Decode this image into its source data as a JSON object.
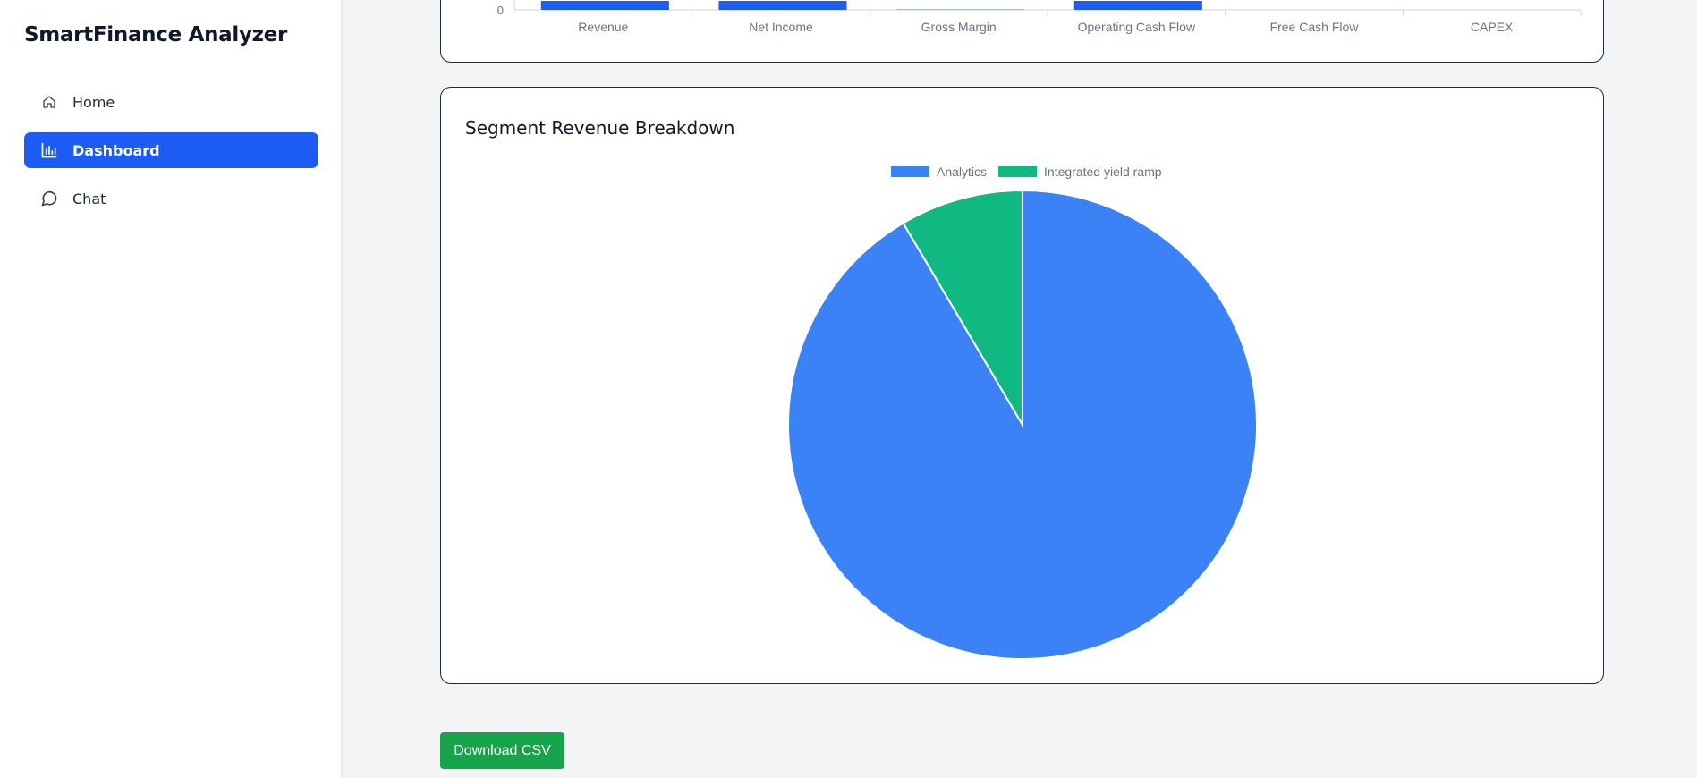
{
  "app": {
    "title": "SmartFinance Analyzer"
  },
  "sidebar": {
    "items": [
      {
        "label": "Home",
        "icon": "home-icon",
        "active": false
      },
      {
        "label": "Dashboard",
        "icon": "bar-chart-icon",
        "active": true
      },
      {
        "label": "Chat",
        "icon": "chat-bubble-icon",
        "active": false
      }
    ]
  },
  "colors": {
    "accent": "#1d5bf5",
    "bar": "#1d5bf5",
    "analytics": "#3b82f6",
    "integrated": "#10b981",
    "download": "#16a34a"
  },
  "chart_data": [
    {
      "type": "bar",
      "categories": [
        "Revenue",
        "Net Income",
        "Gross Margin",
        "Operating Cash Flow",
        "Free Cash Flow",
        "CAPEX"
      ],
      "y_ticks_visible": [
        "0"
      ],
      "values": [
        100,
        100,
        1,
        100,
        0,
        0
      ],
      "title": "",
      "xlabel": "",
      "ylabel": ""
    },
    {
      "type": "pie",
      "title": "Segment Revenue Breakdown",
      "labels": [
        "Analytics",
        "Integrated yield ramp"
      ],
      "values": [
        91.5,
        8.5
      ],
      "colors": [
        "#3b82f6",
        "#10b981"
      ],
      "legend": "top"
    }
  ],
  "actions": {
    "download_label": "Download CSV"
  }
}
